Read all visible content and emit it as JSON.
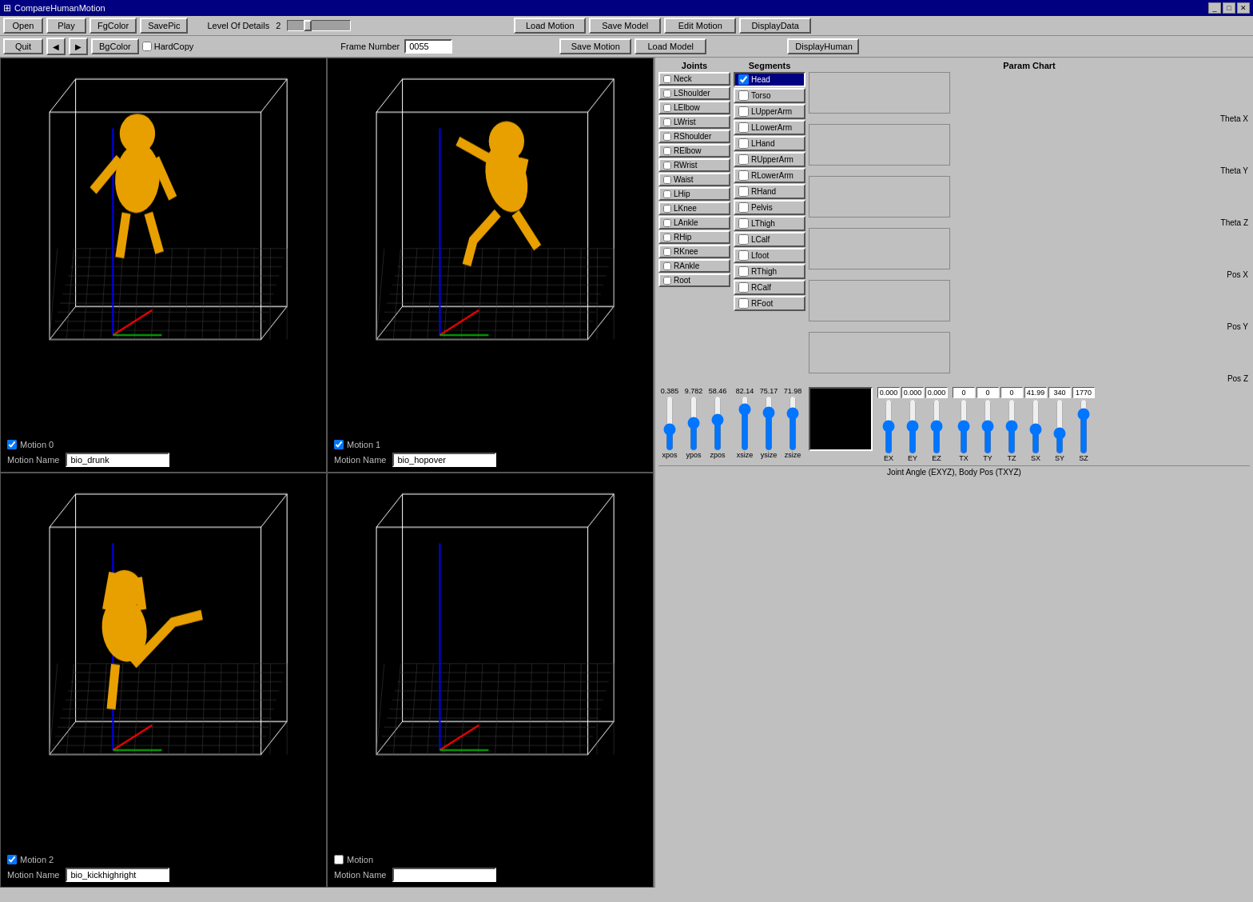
{
  "window": {
    "title": "CompareHumanMotion",
    "icon": "app-icon"
  },
  "toolbar": {
    "open_label": "Open",
    "play_label": "Play",
    "fg_color_label": "FgColor",
    "save_pic_label": "SavePic",
    "quit_label": "Quit",
    "bg_color_label": "BgColor",
    "hard_copy_label": "HardCopy",
    "level_details_label": "Level Of Details",
    "level_value": "2",
    "frame_number_label": "Frame Number",
    "frame_value": "0055",
    "load_motion_label": "Load Motion",
    "save_model_label": "Save Model",
    "edit_motion_label": "Edit Motion",
    "display_data_label": "DisplayData",
    "save_motion_label": "Save Motion",
    "load_model_label": "Load Model",
    "display_human_label": "DisplayHuman"
  },
  "viewports": [
    {
      "id": "vp0",
      "motion_label": "Motion 0",
      "motion_name_label": "Motion Name",
      "motion_name_value": "bio_drunk",
      "has_figure": true
    },
    {
      "id": "vp1",
      "motion_label": "Motion 1",
      "motion_name_label": "Motion Name",
      "motion_name_value": "bio_hopover",
      "has_figure": true
    },
    {
      "id": "vp2",
      "motion_label": "Motion 2",
      "motion_name_label": "Motion Name",
      "motion_name_value": "bio_kickhighright",
      "has_figure": true
    },
    {
      "id": "vp3",
      "motion_label": "Motion",
      "motion_name_label": "Motion Name",
      "motion_name_value": "",
      "has_figure": false
    }
  ],
  "joints": {
    "title": "Joints",
    "items": [
      "Neck",
      "LShoulder",
      "LElbow",
      "LWrist",
      "RShoulder",
      "RElbow",
      "RWrist",
      "Waist",
      "LHip",
      "LKnee",
      "LAnkle",
      "RHip",
      "RKnee",
      "RAnkle",
      "Root"
    ]
  },
  "segments": {
    "title": "Segments",
    "items": [
      "Head",
      "Torso",
      "LUpperArm",
      "LLowerArm",
      "LHand",
      "RUpperArm",
      "RLowerArm",
      "RHand",
      "Pelvis",
      "LThigh",
      "LCalf",
      "Lfoot",
      "RThigh",
      "RCalf",
      "RFoot"
    ],
    "selected": "Head"
  },
  "param_chart": {
    "title": "Param Chart",
    "charts": [
      {
        "label": "Theta X"
      },
      {
        "label": "Theta Y"
      },
      {
        "label": "Theta Z"
      },
      {
        "label": "Pos X"
      },
      {
        "label": "Pos Y"
      },
      {
        "label": "Pos Z"
      }
    ]
  },
  "sliders_pos": {
    "values": [
      "0.385",
      "9.782",
      "58.46"
    ],
    "labels": [
      "xpos",
      "ypos",
      "zpos"
    ]
  },
  "sliders_size": {
    "values": [
      "82.14",
      "75.17",
      "71.98"
    ],
    "labels": [
      "xsize",
      "ysize",
      "zsize"
    ]
  },
  "euler_sliders": {
    "values": [
      "0.000",
      "0.000",
      "0.000"
    ],
    "labels": [
      "EX",
      "EY",
      "EZ"
    ]
  },
  "transform_sliders": {
    "tx_val": "0",
    "ty_val": "0",
    "tz_val": "0",
    "sx_val": "41.99",
    "sy_val": "340",
    "sz_val": "1770",
    "labels": [
      "TX",
      "TY",
      "TZ",
      "SX",
      "SY",
      "SZ"
    ]
  },
  "status_label": "Joint Angle (EXYZ), Body Pos (TXYZ)"
}
